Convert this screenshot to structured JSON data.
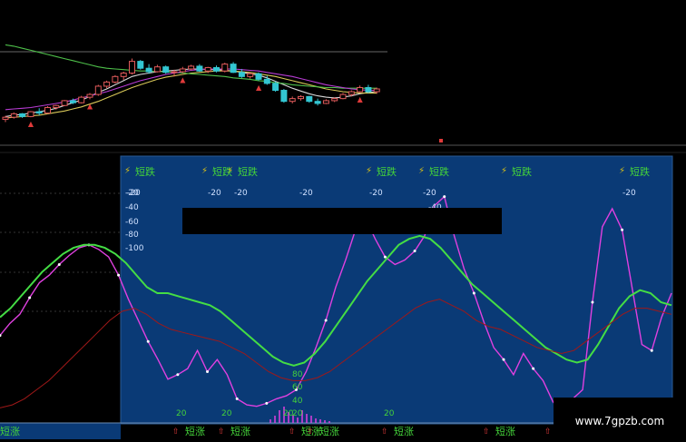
{
  "colors": {
    "background": "#000000",
    "panel": "#0a3a76",
    "panel_edge": "#2a5a94",
    "up": "#e05a5a",
    "down": "#33c6d2",
    "ma_white": "#d8d8d8",
    "ma_yellow": "#d8c858",
    "ma_green": "#4ec04a",
    "ma_magenta": "#b83cd4",
    "osc_magenta": "#e040e0",
    "osc_green": "#44dd44",
    "osc_red": "#a01818",
    "label_yellow": "#d8c018",
    "label_green": "#44d23a",
    "marker_red": "#e03a3a",
    "redacted": "#000000"
  },
  "chart_data": [
    {
      "type": "candlestick",
      "title": "",
      "candles": [
        [
          9.6,
          10.1,
          9.2,
          9.9
        ],
        [
          9.9,
          10.6,
          9.7,
          10.4
        ],
        [
          10.4,
          10.5,
          9.8,
          10.0
        ],
        [
          10.0,
          10.8,
          9.9,
          10.7
        ],
        [
          10.7,
          11.2,
          10.2,
          10.5
        ],
        [
          10.5,
          11.5,
          10.4,
          11.3
        ],
        [
          11.3,
          11.7,
          11.0,
          11.6
        ],
        [
          11.6,
          12.4,
          11.5,
          12.3
        ],
        [
          12.3,
          12.6,
          11.8,
          12.0
        ],
        [
          12.0,
          13.0,
          11.9,
          12.8
        ],
        [
          12.8,
          13.4,
          12.5,
          13.2
        ],
        [
          13.2,
          14.6,
          13.0,
          14.4
        ],
        [
          14.4,
          15.2,
          14.1,
          15.0
        ],
        [
          15.0,
          16.0,
          14.8,
          15.8
        ],
        [
          15.8,
          16.5,
          15.3,
          16.3
        ],
        [
          16.3,
          18.4,
          16.1,
          18.0
        ],
        [
          18.0,
          18.2,
          16.8,
          17.0
        ],
        [
          17.0,
          17.6,
          16.2,
          16.5
        ],
        [
          16.5,
          17.5,
          16.4,
          17.2
        ],
        [
          17.2,
          17.4,
          16.2,
          16.4
        ],
        [
          16.4,
          16.8,
          15.8,
          16.5
        ],
        [
          16.5,
          17.2,
          16.3,
          16.9
        ],
        [
          16.9,
          17.5,
          16.7,
          17.3
        ],
        [
          17.3,
          17.6,
          16.5,
          16.6
        ],
        [
          16.6,
          17.2,
          16.3,
          17.1
        ],
        [
          17.1,
          17.4,
          16.4,
          16.6
        ],
        [
          16.6,
          17.8,
          16.4,
          17.6
        ],
        [
          17.6,
          17.9,
          16.3,
          16.4
        ],
        [
          16.4,
          16.9,
          15.6,
          15.8
        ],
        [
          15.8,
          16.4,
          15.5,
          16.2
        ],
        [
          16.2,
          16.4,
          15.2,
          15.4
        ],
        [
          15.4,
          15.9,
          14.6,
          14.8
        ],
        [
          14.8,
          15.1,
          13.6,
          13.8
        ],
        [
          13.8,
          14.0,
          12.0,
          12.2
        ],
        [
          12.2,
          12.9,
          11.9,
          12.6
        ],
        [
          12.6,
          13.1,
          12.3,
          12.9
        ],
        [
          12.9,
          13.0,
          12.0,
          12.2
        ],
        [
          12.2,
          12.6,
          11.6,
          11.9
        ],
        [
          11.9,
          12.5,
          11.8,
          12.3
        ],
        [
          12.3,
          12.8,
          12.1,
          12.6
        ],
        [
          12.6,
          13.4,
          12.5,
          13.2
        ],
        [
          13.2,
          13.8,
          12.9,
          13.6
        ],
        [
          13.6,
          14.5,
          13.5,
          14.2
        ],
        [
          14.2,
          14.6,
          13.4,
          13.6
        ],
        [
          13.6,
          14.2,
          13.3,
          14.0
        ]
      ],
      "moving_averages": [
        {
          "color": "#d8d8d8",
          "values": [
            10.0,
            10.2,
            10.3,
            10.5,
            10.7,
            10.9,
            11.2,
            11.6,
            12.0,
            12.4,
            12.9,
            13.5,
            14.0,
            14.6,
            15.2,
            15.8,
            16.1,
            16.3,
            16.5,
            16.6,
            16.7,
            16.8,
            16.9,
            16.9,
            16.8,
            16.8,
            16.7,
            16.6,
            16.4,
            16.2,
            16.0,
            15.6,
            15.1,
            14.6,
            14.1,
            13.7,
            13.3,
            13.0,
            12.8,
            12.7,
            12.8,
            13.0,
            13.3,
            13.5,
            13.6
          ]
        },
        {
          "color": "#d8c858",
          "values": [
            9.8,
            9.9,
            10.0,
            10.1,
            10.2,
            10.4,
            10.6,
            10.8,
            11.1,
            11.4,
            11.8,
            12.2,
            12.7,
            13.2,
            13.7,
            14.2,
            14.6,
            15.0,
            15.4,
            15.7,
            15.9,
            16.1,
            16.3,
            16.4,
            16.5,
            16.6,
            16.6,
            16.6,
            16.5,
            16.4,
            16.2,
            16.0,
            15.8,
            15.5,
            15.2,
            14.9,
            14.6,
            14.3,
            14.0,
            13.8,
            13.6,
            13.5,
            13.4,
            13.4,
            13.4
          ]
        },
        {
          "color": "#4ec04a",
          "values": [
            20.4,
            20.2,
            19.9,
            19.6,
            19.3,
            19.0,
            18.7,
            18.4,
            18.1,
            17.8,
            17.5,
            17.2,
            17.0,
            16.9,
            16.8,
            16.7,
            16.6,
            16.6,
            16.5,
            16.5,
            16.4,
            16.3,
            16.2,
            16.1,
            16.0,
            15.9,
            15.8,
            15.6,
            15.5,
            15.4,
            15.2,
            15.1,
            14.9,
            14.8,
            14.6,
            14.5,
            14.4,
            14.3,
            14.2,
            14.2,
            14.1,
            14.1,
            14.1,
            14.1,
            14.1
          ]
        },
        {
          "color": "#b83cd4",
          "values": [
            11.0,
            11.1,
            11.2,
            11.3,
            11.5,
            11.7,
            11.9,
            12.1,
            12.4,
            12.7,
            13.0,
            13.3,
            13.6,
            14.0,
            14.4,
            14.8,
            15.2,
            15.5,
            15.8,
            16.1,
            16.3,
            16.5,
            16.7,
            16.8,
            16.9,
            16.9,
            16.9,
            16.9,
            16.8,
            16.7,
            16.6,
            16.4,
            16.2,
            16.0,
            15.8,
            15.5,
            15.2,
            14.9,
            14.6,
            14.4,
            14.2,
            14.0,
            13.9,
            13.8,
            13.8
          ]
        }
      ],
      "tail_segment": [
        13.9,
        13.8,
        13.6,
        13.4,
        13.2,
        12.9,
        12.7,
        12.8,
        13.1,
        13.5,
        13.8,
        13.9
      ]
    },
    {
      "type": "line",
      "title": "",
      "series": [
        {
          "color": "#e040e0",
          "values": [
            8,
            16,
            22,
            33,
            43,
            48,
            55,
            61,
            66,
            68,
            65,
            60,
            48,
            32,
            18,
            4,
            -8,
            -21,
            -18,
            -14,
            -2,
            -16,
            -8,
            -18,
            -34,
            -38,
            -39,
            -37,
            -34,
            -32,
            -28,
            -16,
            0,
            18,
            40,
            58,
            78,
            86,
            72,
            60,
            55,
            58,
            64,
            74,
            94,
            100,
            74,
            52,
            36,
            17,
            0,
            -8,
            -18,
            -4,
            -14,
            -22,
            -36,
            -44,
            -34,
            -28,
            30,
            80,
            92,
            78,
            40,
            2,
            -2,
            20,
            36
          ]
        },
        {
          "color": "#44dd44",
          "values": [
            20,
            26,
            34,
            42,
            50,
            56,
            62,
            66,
            68,
            68,
            66,
            62,
            56,
            48,
            40,
            36,
            36,
            34,
            32,
            30,
            28,
            24,
            18,
            12,
            6,
            0,
            -6,
            -10,
            -12,
            -10,
            -4,
            4,
            14,
            24,
            34,
            44,
            52,
            60,
            68,
            72,
            74,
            72,
            66,
            58,
            50,
            42,
            36,
            30,
            24,
            18,
            12,
            6,
            0,
            -4,
            -8,
            -10,
            -8,
            2,
            14,
            26,
            34,
            38,
            36,
            30,
            28
          ]
        },
        {
          "color": "#a01818",
          "values": [
            -40,
            -38,
            -34,
            -28,
            -22,
            -14,
            -6,
            2,
            10,
            18,
            24,
            26,
            22,
            16,
            12,
            10,
            8,
            6,
            4,
            0,
            -4,
            -10,
            -16,
            -20,
            -22,
            -22,
            -20,
            -16,
            -10,
            -4,
            2,
            8,
            14,
            20,
            26,
            30,
            32,
            28,
            24,
            18,
            14,
            12,
            8,
            4,
            0,
            -2,
            -4,
            -2,
            4,
            10,
            16,
            22,
            26,
            26,
            24,
            22
          ]
        }
      ],
      "axis_labels_left": [
        "-20",
        "-40",
        "-60",
        "-80",
        "-100"
      ],
      "top_labels": [
        {
          "text": "-20"
        },
        {
          "text": "-20"
        },
        {
          "text": "-20"
        },
        {
          "text": "-20"
        },
        {
          "text": "-20"
        },
        {
          "text": "-20"
        },
        {
          "text": "-40"
        }
      ],
      "bottom_labels": [
        {
          "text": "80"
        },
        {
          "text": "60"
        },
        {
          "text": "40"
        },
        {
          "text": "20"
        },
        {
          "text": "20"
        },
        {
          "text": "20"
        },
        {
          "text": "20"
        },
        {
          "text": "20"
        }
      ],
      "sell_label": "短跌",
      "buy_label": "短涨",
      "sell_markers": 7,
      "buy_markers": 7
    }
  ],
  "watermark": "www.7gpzb.com"
}
